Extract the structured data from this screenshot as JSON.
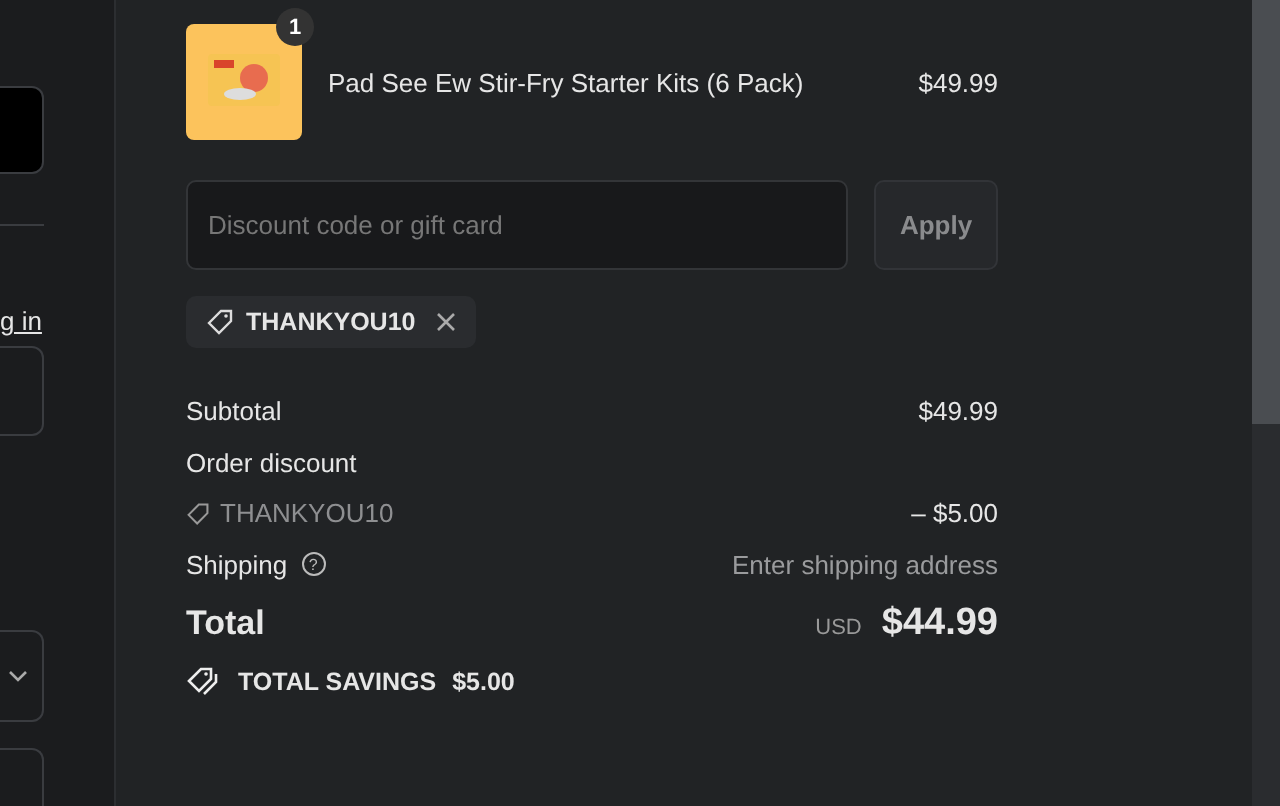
{
  "left_panel": {
    "link": "g in"
  },
  "cart": {
    "items": [
      {
        "name": "Pad See Ew Stir-Fry Starter Kits (6 Pack)",
        "quantity": "1",
        "price": "$49.99"
      }
    ]
  },
  "discount": {
    "placeholder": "Discount code or gift card",
    "button": "Apply",
    "button_disabled": true,
    "applied_codes": [
      {
        "code": "THANKYOU10"
      }
    ]
  },
  "summary": {
    "rows": [
      {
        "kind": "line",
        "label": "Subtotal",
        "value": "$49.99"
      },
      {
        "kind": "heading",
        "label": "Order discount"
      },
      {
        "kind": "code",
        "label": "THANKYOU10",
        "value": "– $5.00"
      },
      {
        "kind": "muted",
        "label": "Shipping",
        "help": "?",
        "value": "Enter shipping address"
      }
    ],
    "total": {
      "label": "Total",
      "currency": "USD",
      "value": "$44.99"
    },
    "savings": {
      "label": "TOTAL SAVINGS",
      "value": "$5.00"
    }
  }
}
